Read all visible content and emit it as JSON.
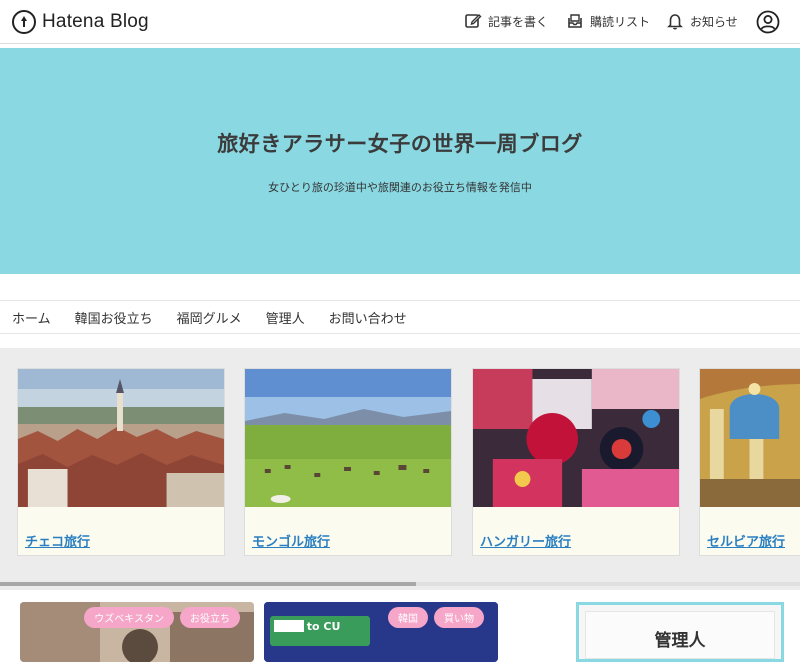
{
  "topbar": {
    "logo_text": "Hatena Blog",
    "actions": {
      "write": "記事を書く",
      "subscriptions": "購読リスト",
      "notifications": "お知らせ"
    }
  },
  "header": {
    "title": "旅好きアラサー女子の世界一周ブログ",
    "description": "女ひとり旅の珍道中や旅関連のお役立ち情報を発信中",
    "background_color": "#8ad8e2"
  },
  "nav": {
    "items": [
      "ホーム",
      "韓国お役立ち",
      "福岡グルメ",
      "管理人",
      "お問い合わせ"
    ]
  },
  "categories": [
    {
      "label": "チェコ旅行"
    },
    {
      "label": "モンゴル旅行"
    },
    {
      "label": "ハンガリー旅行"
    },
    {
      "label": "セルビア旅行"
    }
  ],
  "posts": [
    {
      "tags": [
        "ウズベキスタン",
        "お役立ち"
      ]
    },
    {
      "tags": [
        "韓国",
        "買い物"
      ],
      "image_text": "Nice to CU"
    }
  ],
  "sidebar": {
    "title": "管理人"
  },
  "colors": {
    "accent": "#8ad8e2",
    "link": "#2a7fc0",
    "tag": "#f6a6c8"
  }
}
